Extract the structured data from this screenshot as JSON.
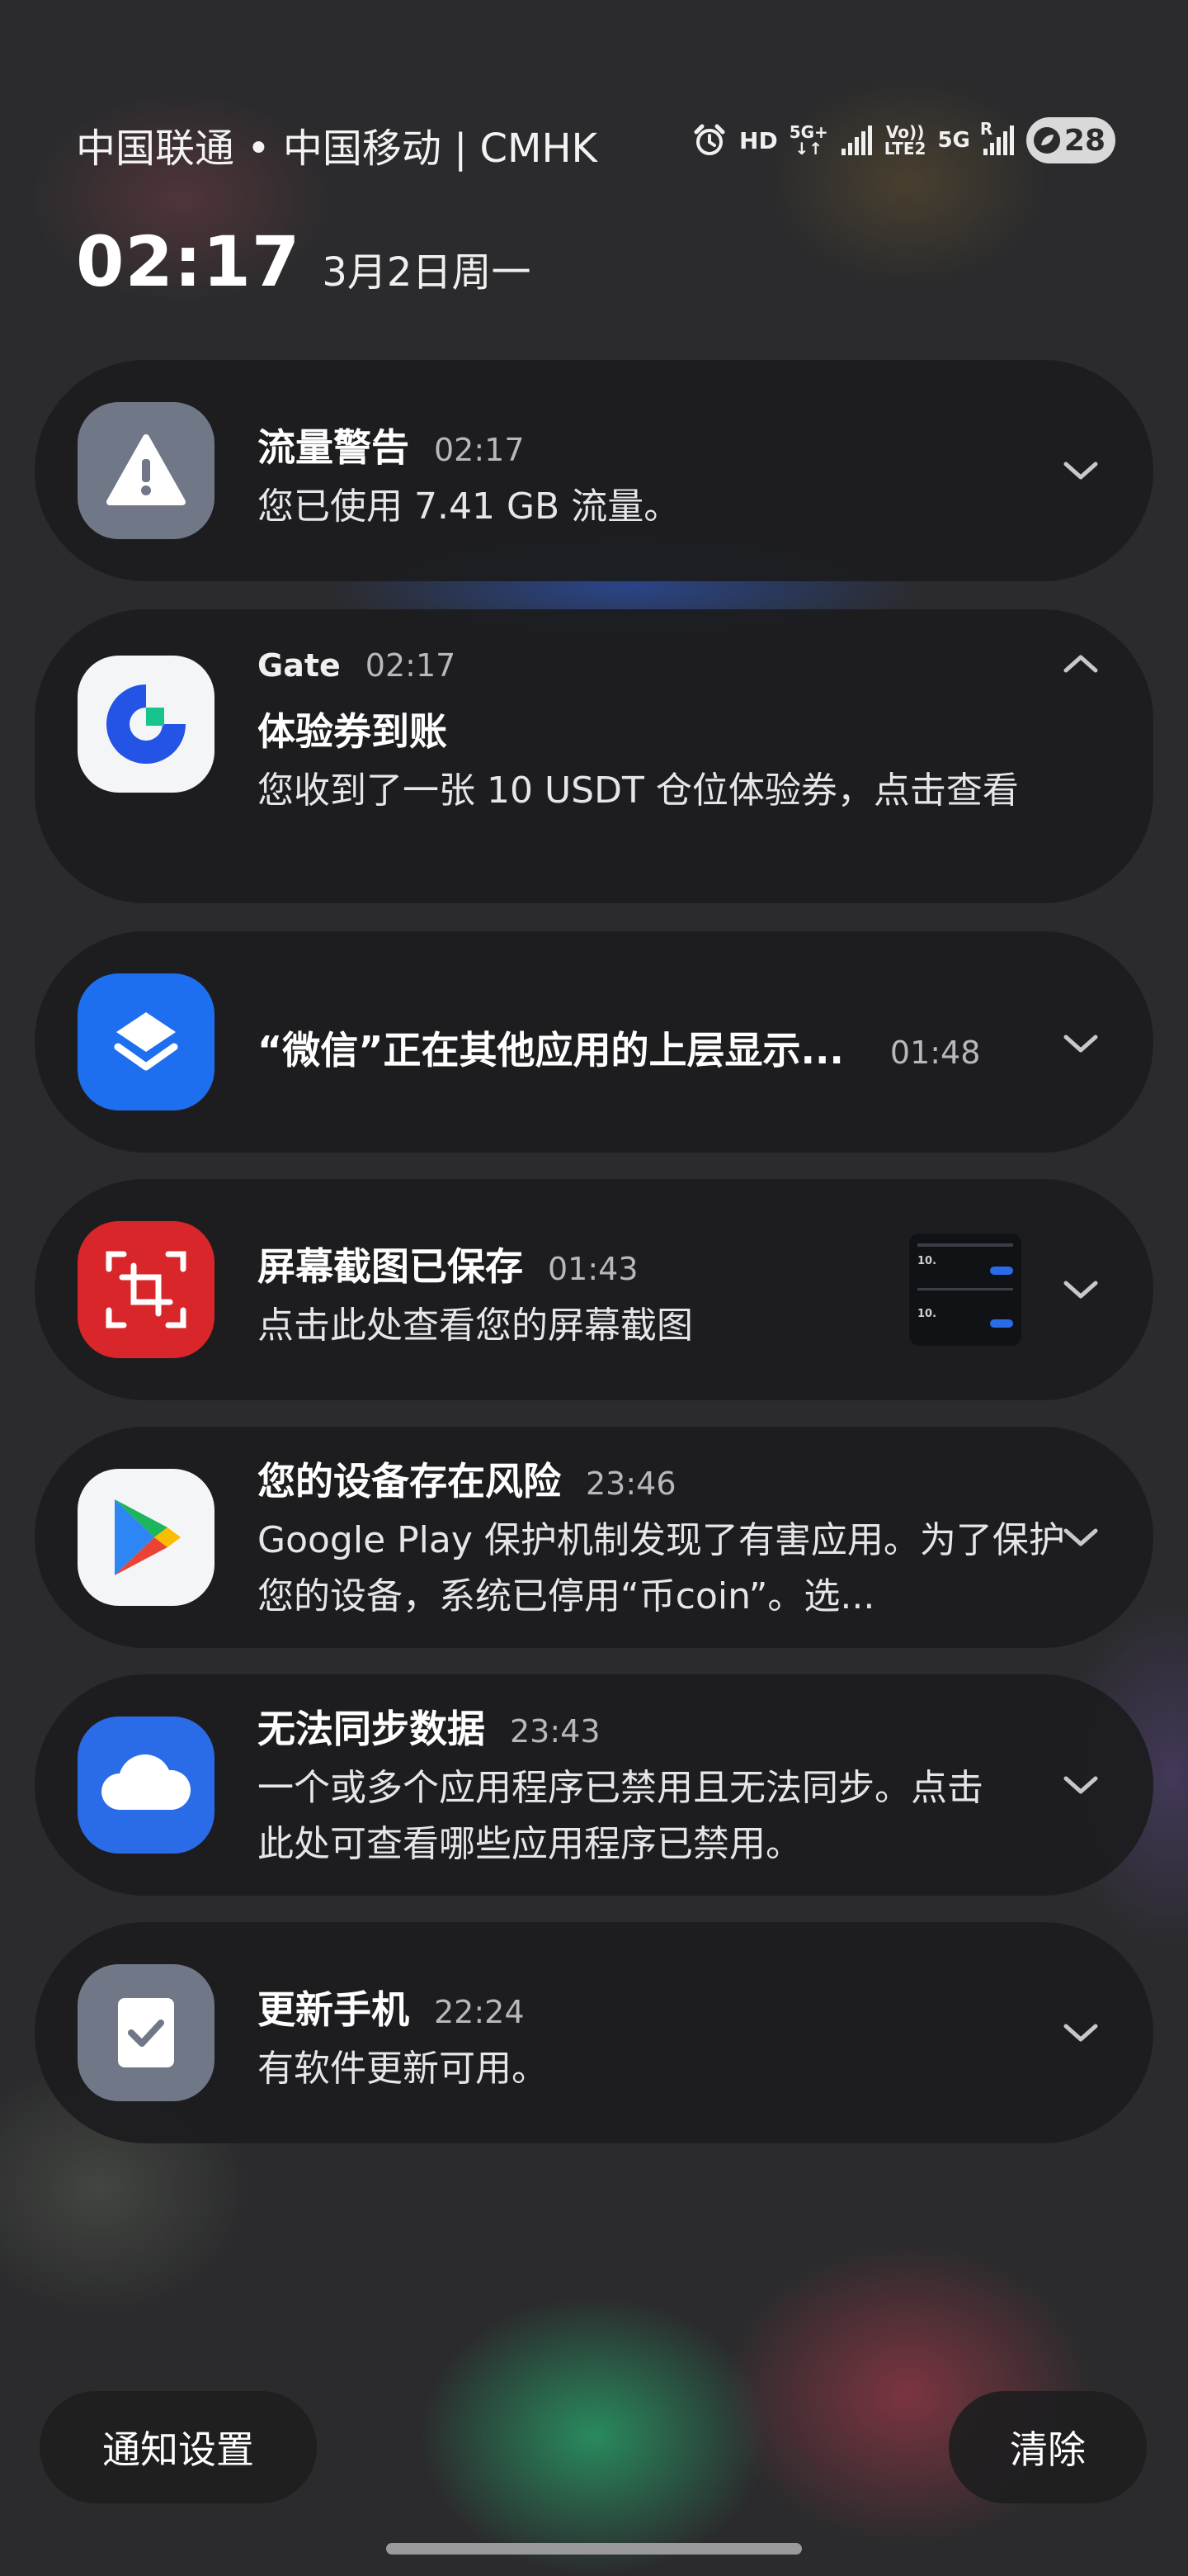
{
  "status_bar": {
    "carrier": "中国联通 • 中国移动 | CMHK",
    "hd": "HD",
    "net1_top": "5G+",
    "net1_bottom": "↓↑",
    "volte_top": "Vo))",
    "volte_bottom": "LTE2",
    "net2": "5G",
    "roaming": "R",
    "battery": "28",
    "icons": [
      "alarm-icon",
      "signal-icon",
      "signal-icon",
      "battery-saver-icon"
    ]
  },
  "lock": {
    "time": "02:17",
    "date": "3月2日周一"
  },
  "notifications": [
    {
      "icon": "warning-icon",
      "title": "流量警告",
      "time": "02:17",
      "body": "您已使用 7.41 GB 流量。",
      "expanded": false
    },
    {
      "icon": "gate-logo-icon",
      "app": "Gate",
      "time": "02:17",
      "title": "体验券到账",
      "body": "您收到了一张 10 USDT 仓位体验券，点击查看",
      "expanded": true
    },
    {
      "icon": "layers-icon",
      "title": "“微信”正在其他应用的上层显示...",
      "time": "01:48",
      "expanded": false
    },
    {
      "icon": "screenshot-icon",
      "title": "屏幕截图已保存",
      "time": "01:43",
      "body": "点击此处查看您的屏幕截图",
      "thumb_text1": "10.",
      "thumb_text2": "10.",
      "expanded": false
    },
    {
      "icon": "google-play-icon",
      "title": "您的设备存在风险",
      "time": "23:46",
      "body": "Google Play 保护机制发现了有害应用。为了保护您的设备，系统已停用“币coin”。选...",
      "expanded": false
    },
    {
      "icon": "cloud-icon",
      "title": "无法同步数据",
      "time": "23:43",
      "body": "一个或多个应用程序已禁用且无法同步。点击此处可查看哪些应用程序已禁用。",
      "expanded": false
    },
    {
      "icon": "update-check-icon",
      "title": "更新手机",
      "time": "22:24",
      "body": "有软件更新可用。",
      "expanded": false
    }
  ],
  "bottom": {
    "settings_label": "通知设置",
    "clear_label": "清除"
  },
  "colors": {
    "card_bg": "#1c1c1e",
    "warning_icon_bg": "#707888",
    "wechat_overlay_bg": "#1e6ff0",
    "screenshot_bg": "#d9262a",
    "cloud_bg": "#2a6be8",
    "gate_blue": "#2354e6",
    "gate_green": "#17c48b"
  }
}
